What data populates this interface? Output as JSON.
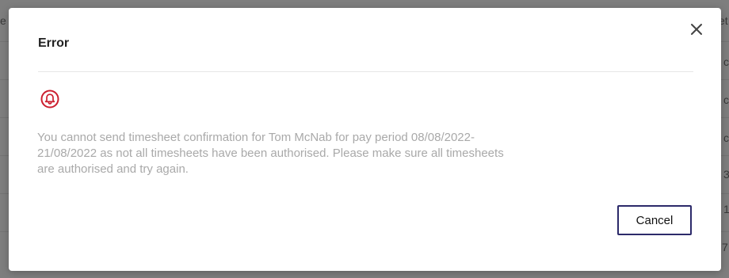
{
  "background": {
    "cells": [
      {
        "text": "e"
      },
      {
        "text": "et"
      },
      {
        "text": "c"
      },
      {
        "text": "c"
      },
      {
        "text": "c"
      },
      {
        "text": "3"
      },
      {
        "text": "1"
      },
      {
        "text": "7"
      }
    ]
  },
  "dialog": {
    "title": "Error",
    "close_icon": "close-icon",
    "alert_icon": "bell-alert-icon",
    "alert_color": "#cc1f2f",
    "message": "You cannot send timesheet confirmation for Tom McNab for pay period 08/08/2022-21/08/2022 as not all timesheets have been authorised. Please make sure all timesheets are authorised and try again.",
    "cancel_label": "Cancel",
    "cancel_border_color": "#2c2a6a"
  }
}
